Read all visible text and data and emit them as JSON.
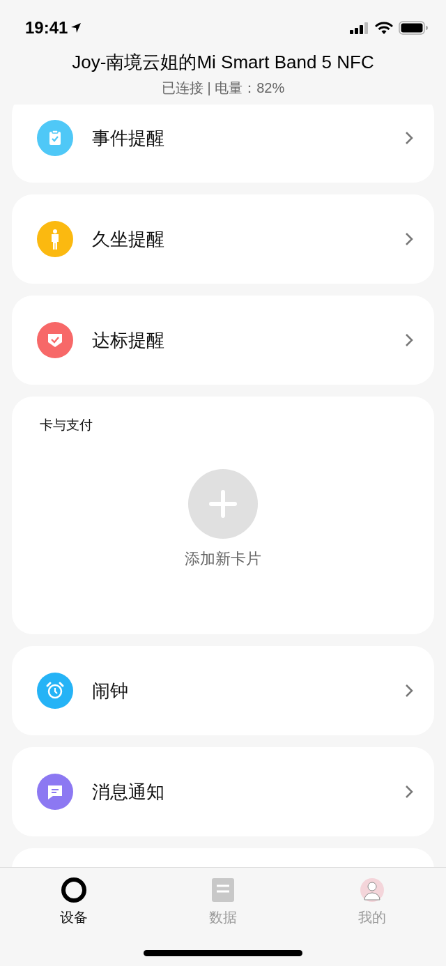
{
  "status_bar": {
    "time": "19:41"
  },
  "header": {
    "title": "Joy-南境云姐的Mi Smart Band 5 NFC",
    "subtitle": "已连接 | 电量：82%"
  },
  "sections": [
    {
      "kind": "menu",
      "label": "事件提醒",
      "color": "#4fc8f7"
    },
    {
      "kind": "menu",
      "label": "久坐提醒",
      "color": "#fbb910"
    },
    {
      "kind": "menu",
      "label": "达标提醒",
      "color": "#f76868"
    },
    {
      "kind": "cards",
      "title": "卡与支付",
      "add_label": "添加新卡片"
    },
    {
      "kind": "menu",
      "label": "闹钟",
      "color": "#25b3f6"
    },
    {
      "kind": "menu",
      "label": "消息通知",
      "color": "#8c78f2"
    }
  ],
  "tab_bar": [
    {
      "label": "设备",
      "selected": true
    },
    {
      "label": "数据",
      "selected": false
    },
    {
      "label": "我的",
      "selected": false
    }
  ]
}
